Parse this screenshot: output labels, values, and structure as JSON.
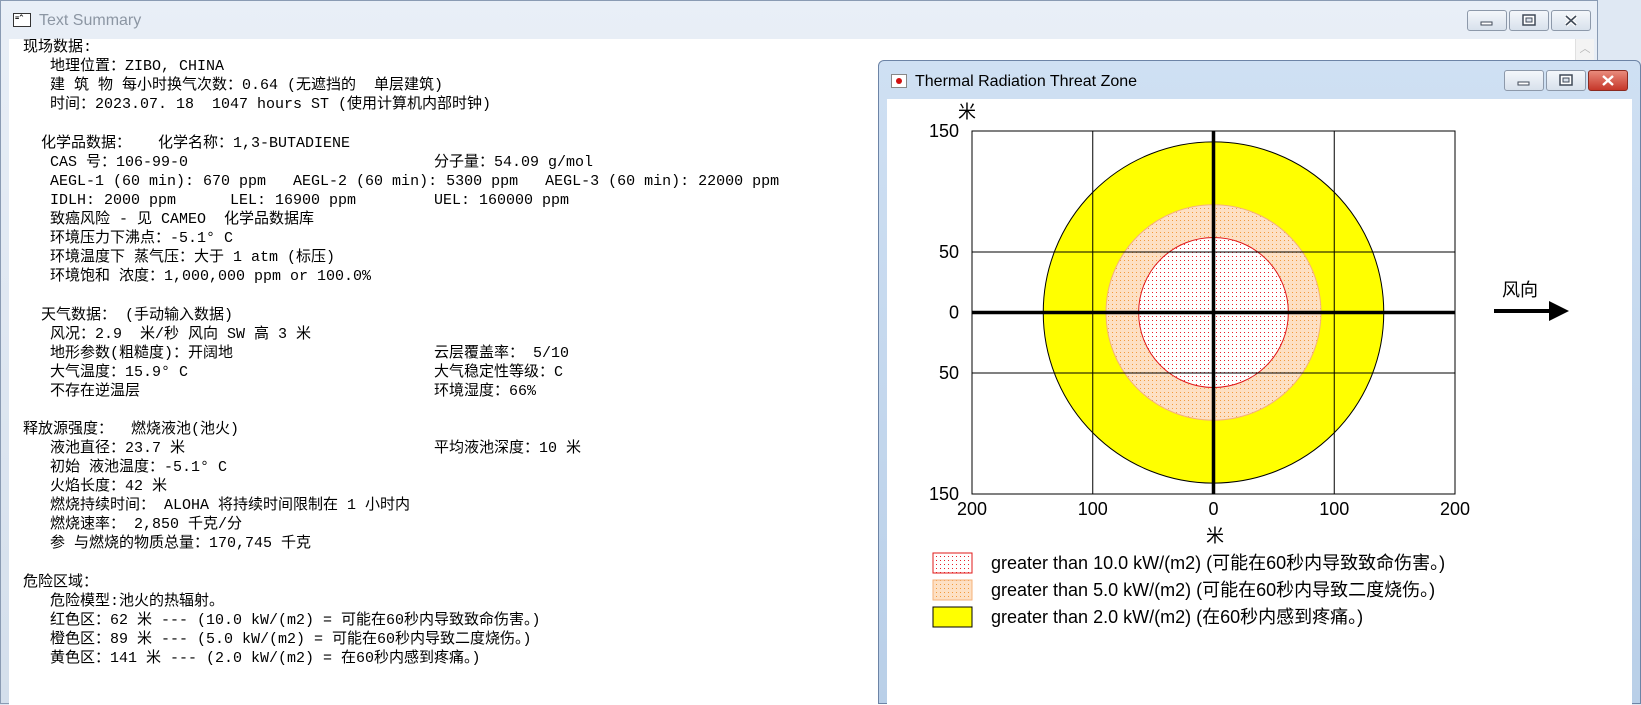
{
  "summary_window": {
    "title": "Text Summary",
    "icon": "app-window-icon",
    "lines": [
      "现场数据:",
      "   地理位置：ZIBO, CHINA",
      "   建 筑 物 每小时换气次数：0.64 (无遮挡的  单层建筑)",
      "   时间：2023.07. 18  1047 hours ST (使用计算机内部时钟)",
      "  化学品数据：   化学名称：1,3-BUTADIENE",
      "   CAS 号：106-99-0",
      "   AEGL-1 (60 min): 670 ppm   AEGL-2 (60 min): 5300 ppm   AEGL-3 (60 min): 22000 ppm",
      "   IDLH: 2000 ppm      LEL: 16900 ppm",
      "   致癌风险 - 见 CAMEO  化学品数据库",
      "   环境压力下沸点：-5.1° C",
      "   环境温度下 蒸气压：大于 1 atm (标压)",
      "   环境饱和 浓度：1,000,000 ppm or 100.0%",
      "  天气数据： (手动输入数据)",
      "   风况：2.9  米/秒 风向 SW 高 3 米",
      "   地形参数(粗糙度)：开阔地",
      "   大气温度：15.9° C",
      "   不存在逆温层",
      "释放源强度：  燃烧液池(池火)",
      "   液池直径：23.7 米",
      "   初始 液池温度：-5.1° C",
      "   火焰长度：42 米",
      "   燃烧持续时间： ALOHA 将持续时间限制在 1 小时内",
      "   燃烧速率： 2,850 千克/分",
      "   参 与燃烧的物质总量：170,745 千克",
      "危险区域：",
      "   危险模型:池火的热辐射。",
      "   红色区：62 米 --- (10.0 kW/(m2) = 可能在60秒内导致致命伤害。)",
      "   橙色区：89 米 --- (5.0 kW/(m2) = 可能在60秒内导致二度烧伤。)",
      "   黄色区：141 米 --- (2.0 kW/(m2) = 在60秒内感到疼痛。)"
    ],
    "right_column": [
      "分子量：54.09 g/mol",
      "UEL: 160000 ppm",
      "云层覆盖率： 5/10",
      "大气稳定性等级：C",
      "环境湿度：66%",
      "平均液池深度：10 米"
    ]
  },
  "threat_window": {
    "title": "Thermal Radiation Threat Zone",
    "wind_label": "风向",
    "y_unit": "米",
    "x_unit": "米",
    "colors": {
      "red_edge": "#e01818",
      "red_dots": "#e8202a",
      "orange_fill": "#fde0c4",
      "orange_dots": "#f39a3c",
      "yellow_fill": "#ffff00"
    }
  },
  "chart_data": {
    "type": "threat-zone",
    "xlim": [
      -200,
      200
    ],
    "ylim": [
      -150,
      150
    ],
    "x_ticks": [
      -200,
      -100,
      0,
      100,
      200
    ],
    "x_tick_labels": [
      "200",
      "100",
      "0",
      "100",
      "200"
    ],
    "y_ticks": [
      150,
      50,
      0,
      -50,
      -150
    ],
    "y_tick_labels": [
      "150",
      "50",
      "0",
      "50",
      "150"
    ],
    "zones": [
      {
        "radius": 141,
        "color": "yellow",
        "label": "greater than 2.0 kW/(m2) (在60秒内感到疼痛。)"
      },
      {
        "radius": 89,
        "color": "orange",
        "label": "greater than 5.0 kW/(m2) (可能在60秒内导致二度烧伤。)"
      },
      {
        "radius": 62,
        "color": "red",
        "label": "greater than 10.0 kW/(m2) (可能在60秒内导致致命伤害。)"
      }
    ],
    "legend_order": [
      "red",
      "orange",
      "yellow"
    ]
  }
}
